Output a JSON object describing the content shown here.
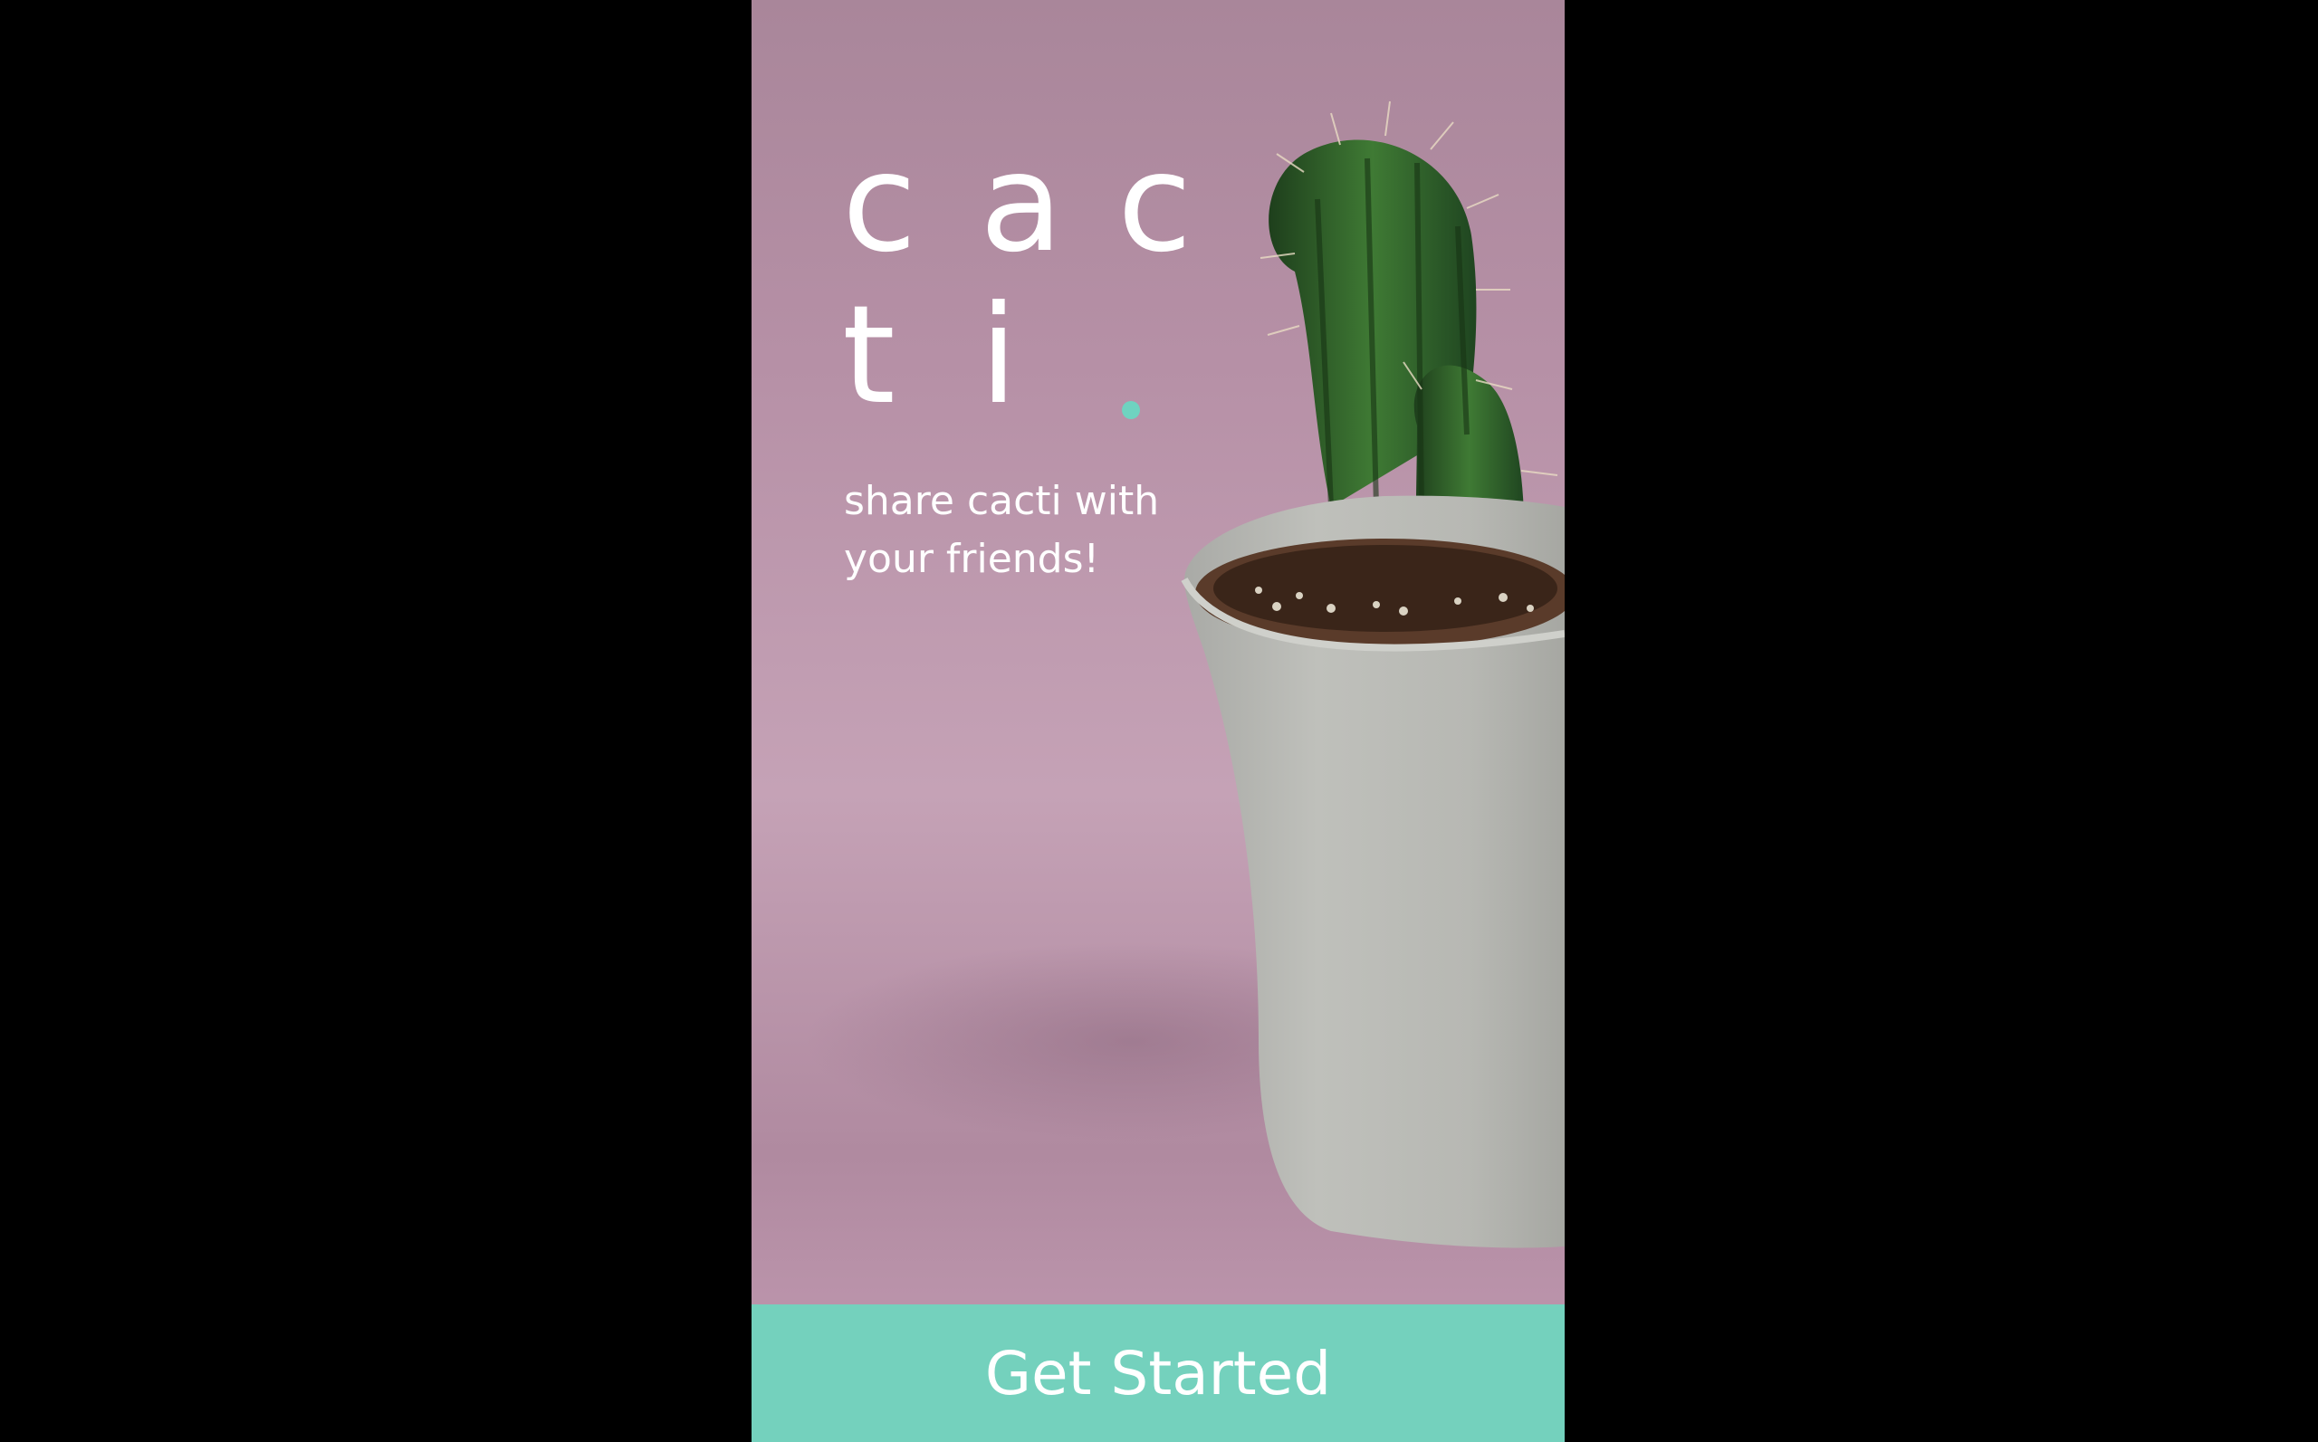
{
  "brand": {
    "logo_row_1": [
      "c",
      "a",
      "c"
    ],
    "logo_row_2": [
      "t",
      "i"
    ],
    "accent_color": "#6fd3c0"
  },
  "hero": {
    "tagline_line_1": "share cacti with",
    "tagline_line_2": "your friends!",
    "background_image": "potted-cactus-photo"
  },
  "cta": {
    "label": "Get Started",
    "color": "#74d1bd"
  }
}
